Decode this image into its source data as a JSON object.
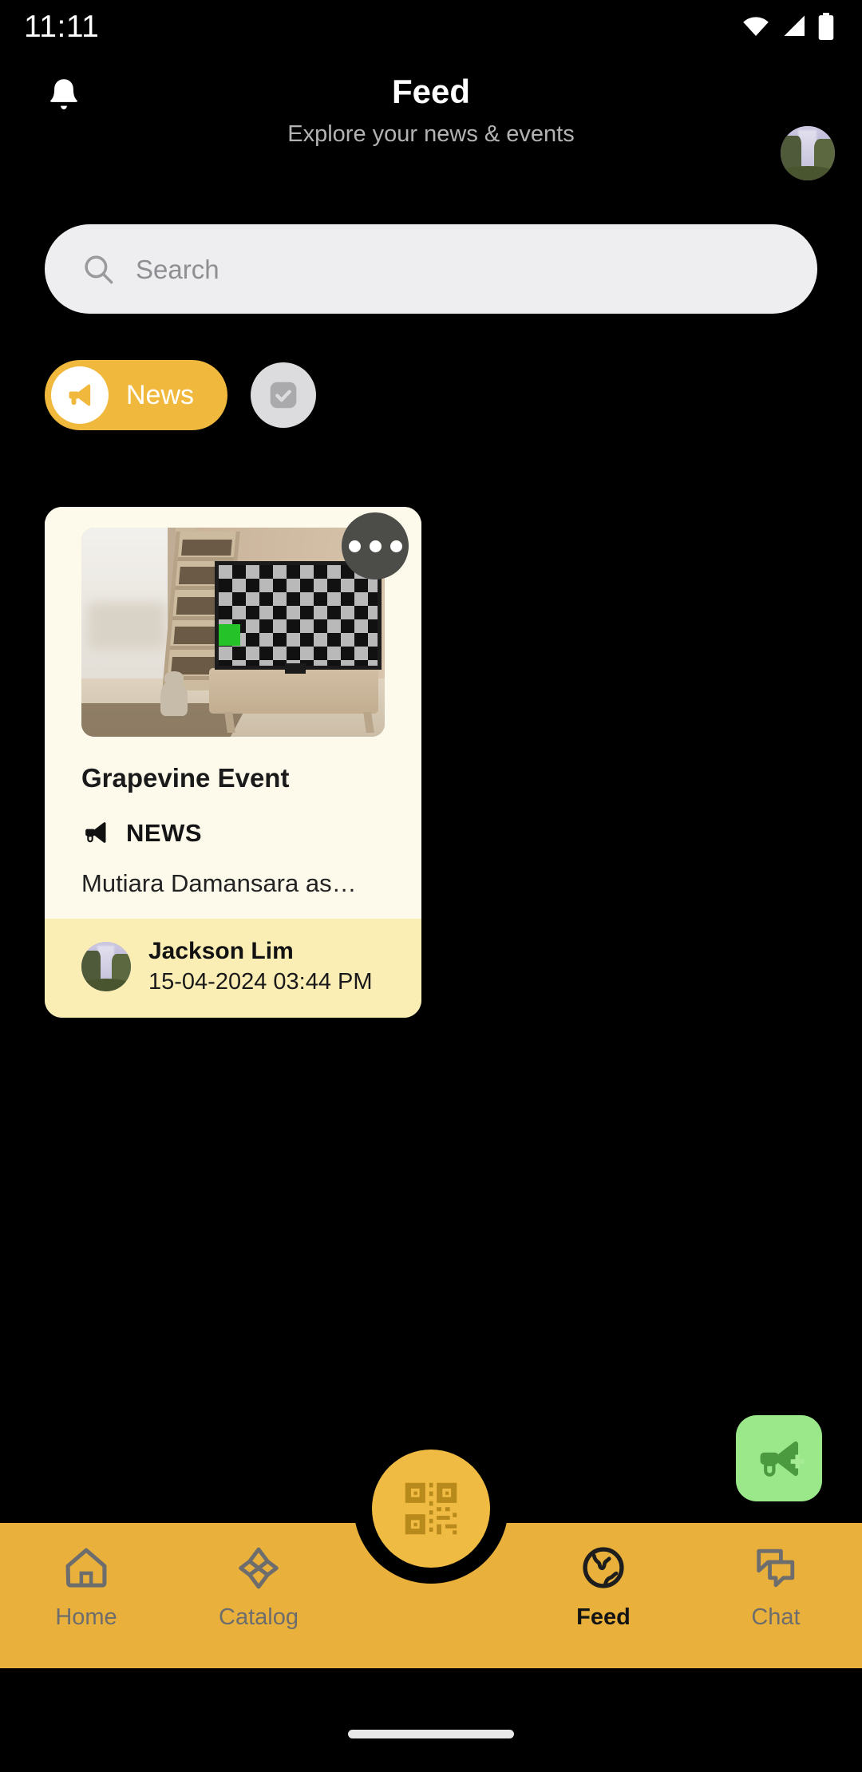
{
  "status_bar": {
    "time": "11:11",
    "icons": [
      "wifi-icon",
      "cellular-signal-icon",
      "battery-icon"
    ]
  },
  "header": {
    "title": "Feed",
    "subtitle": "Explore your news & events",
    "notifications_icon": "bell-icon",
    "avatar_alt": "User profile avatar"
  },
  "search": {
    "icon": "search-icon",
    "placeholder": "Search",
    "value": ""
  },
  "filters": {
    "chips": [
      {
        "label": "News",
        "icon": "megaphone-icon",
        "selected": true
      },
      {
        "label": "",
        "icon": "calendar-check-icon",
        "selected": false
      }
    ]
  },
  "feed": {
    "cards": [
      {
        "title": "Grapevine Event",
        "tag_label": "NEWS",
        "tag_icon": "megaphone-icon",
        "description": "Mutiara Damansara as…",
        "more_icon": "more-horizontal-icon",
        "author": "Jackson Lim",
        "timestamp": "15-04-2024 03:44 PM",
        "thumbnail_alt": "Living room with TV showing checkerboard test pattern"
      }
    ]
  },
  "fab": {
    "create_news_icon": "megaphone-plus-icon",
    "create_news_label": "",
    "qr_icon": "qr-code-icon",
    "qr_label": ""
  },
  "bottom_nav": {
    "items": [
      {
        "label": "Home",
        "icon": "home-icon",
        "active": false
      },
      {
        "label": "Catalog",
        "icon": "diamond-grid-icon",
        "active": false
      },
      {
        "label": "Feed",
        "icon": "globe-icon",
        "active": true
      },
      {
        "label": "Chat",
        "icon": "chat-bubbles-icon",
        "active": false
      }
    ]
  },
  "colors": {
    "background": "#000000",
    "accent_amber": "#E9B13C",
    "chip_amber": "#F0B93E",
    "card_body": "#FDFAEB",
    "card_footer": "#FBEEB5",
    "fab_green": "#9AE88A",
    "fab_green_icon": "#4C9A3F",
    "search_field": "#EEEEF0",
    "nav_inactive": "#6D6D6D",
    "nav_active": "#141414"
  }
}
